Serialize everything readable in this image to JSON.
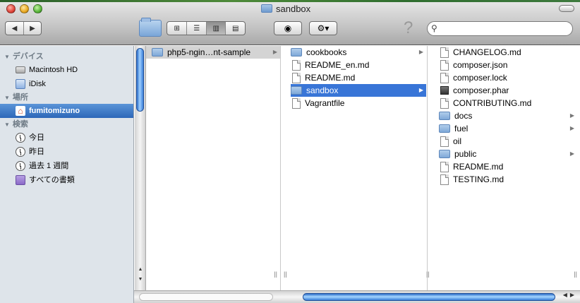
{
  "window": {
    "title": "sandbox"
  },
  "toolbar": {
    "back_glyph": "◀",
    "forward_glyph": "▶",
    "view_icons": [
      "⊞",
      "☰",
      "▥",
      "▤"
    ],
    "eye_glyph": "◉",
    "gear_glyph": "⚙▾",
    "help_glyph": "?",
    "search_placeholder": "",
    "search_icon_glyph": "⚲"
  },
  "sidebar": {
    "devices_header": "デバイス",
    "devices": [
      {
        "label": "Macintosh HD",
        "icon": "hard-drive-icon"
      },
      {
        "label": "iDisk",
        "icon": "idisk-icon"
      }
    ],
    "places_header": "場所",
    "places": [
      {
        "label": "fumitomizuno",
        "icon": "home-icon",
        "selected": true
      }
    ],
    "search_header": "検索",
    "searches": [
      {
        "label": "今日",
        "icon": "clock-icon"
      },
      {
        "label": "昨日",
        "icon": "clock-icon"
      },
      {
        "label": "過去 1 週間",
        "icon": "clock-icon"
      },
      {
        "label": "すべての書類",
        "icon": "all-documents-icon"
      }
    ]
  },
  "columns": [
    {
      "items": [
        {
          "name": "php5-ngin…nt-sample",
          "type": "folder",
          "has_children": true,
          "state": "path"
        }
      ]
    },
    {
      "items": [
        {
          "name": "cookbooks",
          "type": "folder",
          "has_children": true,
          "state": ""
        },
        {
          "name": "README_en.md",
          "type": "file",
          "has_children": false,
          "state": ""
        },
        {
          "name": "README.md",
          "type": "file",
          "has_children": false,
          "state": ""
        },
        {
          "name": "sandbox",
          "type": "folder",
          "has_children": true,
          "state": "selected"
        },
        {
          "name": "Vagrantfile",
          "type": "file",
          "has_children": false,
          "state": ""
        }
      ]
    },
    {
      "items": [
        {
          "name": "CHANGELOG.md",
          "type": "file",
          "has_children": false
        },
        {
          "name": "composer.json",
          "type": "file",
          "has_children": false
        },
        {
          "name": "composer.lock",
          "type": "file",
          "has_children": false
        },
        {
          "name": "composer.phar",
          "type": "binary",
          "has_children": false
        },
        {
          "name": "CONTRIBUTING.md",
          "type": "file",
          "has_children": false
        },
        {
          "name": "docs",
          "type": "folder",
          "has_children": true
        },
        {
          "name": "fuel",
          "type": "folder",
          "has_children": true
        },
        {
          "name": "oil",
          "type": "file",
          "has_children": false
        },
        {
          "name": "public",
          "type": "folder",
          "has_children": true
        },
        {
          "name": "README.md",
          "type": "file",
          "has_children": false
        },
        {
          "name": "TESTING.md",
          "type": "file",
          "has_children": false
        }
      ]
    }
  ],
  "colors": {
    "selection_blue": "#3875d7",
    "sidebar_bg": "#dee4ea",
    "sidebar_header": "#6e7a85"
  }
}
